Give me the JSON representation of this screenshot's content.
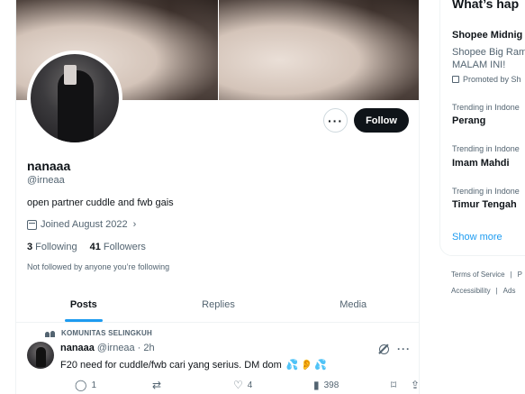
{
  "profile": {
    "name": "nanaaa",
    "handle": "@irneaa",
    "bio": "open partner cuddle and fwb gais",
    "joined": "Joined August 2022",
    "following_count": "3",
    "following_label": "Following",
    "followers_count": "41",
    "followers_label": "Followers",
    "not_followed": "Not followed by anyone you’re following",
    "more_label": "···",
    "follow_label": "Follow"
  },
  "tabs": [
    {
      "label": "Posts",
      "active": true
    },
    {
      "label": "Replies",
      "active": false
    },
    {
      "label": "Media",
      "active": false
    }
  ],
  "post": {
    "community": "KOMUNITAS SELINGKUH",
    "author": "nanaaa",
    "handle": "@irneaa",
    "time": "· 2h",
    "text": "F20 need for cuddle/fwb cari yang serius. DM dom",
    "more_label": "···",
    "replies": "1",
    "reposts": "",
    "likes": "4",
    "views": "398"
  },
  "sidebar": {
    "title": "What’s hap",
    "promo": {
      "title": "Shopee Midnig",
      "body_line1": "Shopee Big Ram",
      "body_line2": "MALAM INI!",
      "promoted": "Promoted by Sh"
    },
    "trends": [
      {
        "category": "Trending in Indone",
        "name": "Perang"
      },
      {
        "category": "Trending in Indone",
        "name": "Imam Mahdi"
      },
      {
        "category": "Trending in Indone",
        "name": "Timur Tengah"
      }
    ],
    "show_more": "Show more",
    "footer_line1": [
      "Terms of Service",
      "|",
      "P"
    ],
    "footer_line2": [
      "Accessibility",
      "|",
      "Ads"
    ]
  },
  "colors": {
    "accent": "#1d9bf0",
    "text": "#0f1419",
    "muted": "#536471",
    "border": "#eff3f4"
  }
}
